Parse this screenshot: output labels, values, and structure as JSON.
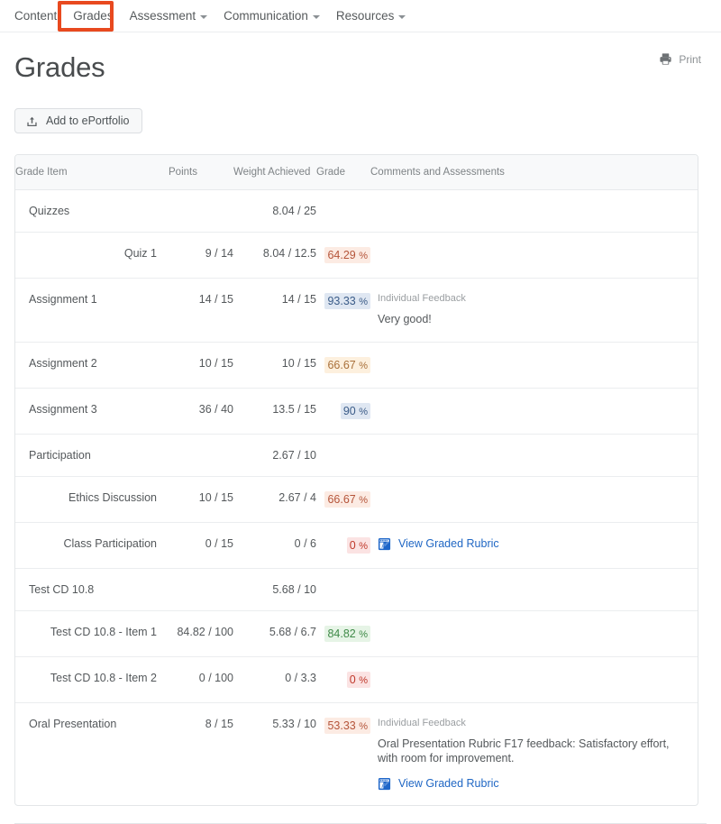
{
  "nav": {
    "items": [
      {
        "label": "Content",
        "has_caret": false,
        "highlighted": false
      },
      {
        "label": "Grades",
        "has_caret": false,
        "highlighted": true
      },
      {
        "label": "Assessment",
        "has_caret": true,
        "highlighted": false
      },
      {
        "label": "Communication",
        "has_caret": true,
        "highlighted": false
      },
      {
        "label": "Resources",
        "has_caret": true,
        "highlighted": false
      }
    ],
    "annotation_color": "#e8491f"
  },
  "header": {
    "title": "Grades",
    "print_label": "Print",
    "print_icon": "printer-icon"
  },
  "toolbar": {
    "eportfolio_label": "Add to ePortfolio",
    "eportfolio_icon": "upload-icon"
  },
  "table": {
    "columns": {
      "grade_item": "Grade Item",
      "points": "Points",
      "weight_achieved": "Weight Achieved",
      "grade": "Grade",
      "comments": "Comments and Assessments"
    },
    "rows": [
      {
        "name": "Quizzes",
        "indent": false,
        "points": "",
        "weight": "8.04 / 25",
        "grade": "",
        "grade_style": "",
        "feedback_label": "",
        "feedback_text": "",
        "rubric_link": ""
      },
      {
        "name": "Quiz 1",
        "indent": true,
        "points": "9 / 14",
        "weight": "8.04 / 12.5",
        "grade": "64.29",
        "grade_style": "v-peach",
        "feedback_label": "",
        "feedback_text": "",
        "rubric_link": ""
      },
      {
        "name": "Assignment 1",
        "indent": false,
        "points": "14 / 15",
        "weight": "14 / 15",
        "grade": "93.33",
        "grade_style": "v-blue",
        "feedback_label": "Individual Feedback",
        "feedback_text": "Very good!",
        "rubric_link": ""
      },
      {
        "name": "Assignment 2",
        "indent": false,
        "points": "10 / 15",
        "weight": "10 / 15",
        "grade": "66.67",
        "grade_style": "v-orange",
        "feedback_label": "",
        "feedback_text": "",
        "rubric_link": ""
      },
      {
        "name": "Assignment 3",
        "indent": false,
        "points": "36 / 40",
        "weight": "13.5 / 15",
        "grade": "90",
        "grade_style": "v-blue",
        "feedback_label": "",
        "feedback_text": "",
        "rubric_link": ""
      },
      {
        "name": "Participation",
        "indent": false,
        "points": "",
        "weight": "2.67 / 10",
        "grade": "",
        "grade_style": "",
        "feedback_label": "",
        "feedback_text": "",
        "rubric_link": ""
      },
      {
        "name": "Ethics Discussion",
        "indent": true,
        "points": "10 / 15",
        "weight": "2.67 / 4",
        "grade": "66.67",
        "grade_style": "v-peach",
        "feedback_label": "",
        "feedback_text": "",
        "rubric_link": ""
      },
      {
        "name": "Class Participation",
        "indent": true,
        "points": "0 / 15",
        "weight": "0 / 6",
        "grade": "0",
        "grade_style": "v-red",
        "feedback_label": "",
        "feedback_text": "",
        "rubric_link": "View Graded Rubric"
      },
      {
        "name": "Test CD 10.8",
        "indent": false,
        "points": "",
        "weight": "5.68 / 10",
        "grade": "",
        "grade_style": "",
        "feedback_label": "",
        "feedback_text": "",
        "rubric_link": ""
      },
      {
        "name": "Test CD 10.8 - Item 1",
        "indent": true,
        "points": "84.82 / 100",
        "weight": "5.68 / 6.7",
        "grade": "84.82",
        "grade_style": "v-green",
        "feedback_label": "",
        "feedback_text": "",
        "rubric_link": ""
      },
      {
        "name": "Test CD 10.8 - Item 2",
        "indent": true,
        "points": "0 / 100",
        "weight": "0 / 3.3",
        "grade": "0",
        "grade_style": "v-red",
        "feedback_label": "",
        "feedback_text": "",
        "rubric_link": ""
      },
      {
        "name": "Oral Presentation",
        "indent": false,
        "points": "8 / 15",
        "weight": "5.33 / 10",
        "grade": "53.33",
        "grade_style": "v-peach",
        "feedback_label": "Individual Feedback",
        "feedback_text": "Oral Presentation Rubric F17 feedback: Satisfactory effort, with room for improvement.",
        "rubric_link": "View Graded Rubric"
      }
    ],
    "percent_symbol": "%"
  }
}
